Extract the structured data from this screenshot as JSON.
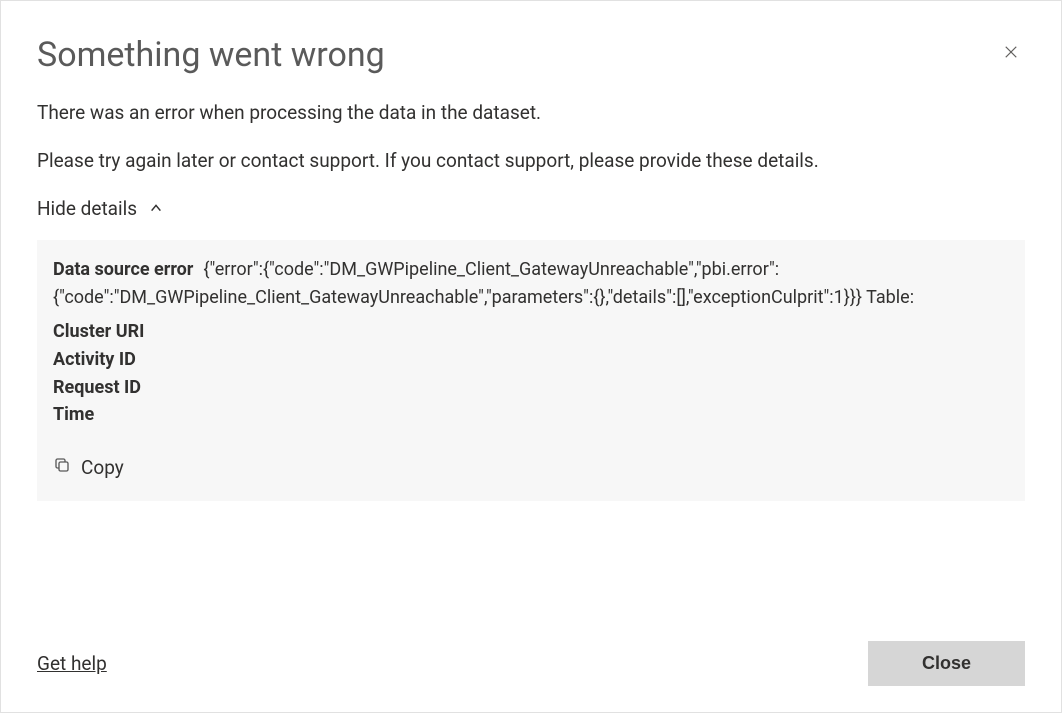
{
  "dialog": {
    "title": "Something went wrong",
    "message1": "There was an error when processing the data in the dataset.",
    "message2": "Please try again later or contact support. If you contact support, please provide these details.",
    "toggle_label": "Hide details"
  },
  "details": {
    "data_source_error_label": "Data source error",
    "data_source_error_value": "{\"error\":{\"code\":\"DM_GWPipeline_Client_GatewayUnreachable\",\"pbi.error\":{\"code\":\"DM_GWPipeline_Client_GatewayUnreachable\",\"parameters\":{},\"details\":[],\"exceptionCulprit\":1}}} Table:",
    "cluster_uri_label": "Cluster URI",
    "cluster_uri_value": "",
    "activity_id_label": "Activity ID",
    "activity_id_value": "",
    "request_id_label": "Request ID",
    "request_id_value": "",
    "time_label": "Time",
    "time_value": "",
    "copy_label": "Copy"
  },
  "footer": {
    "help_link": "Get help",
    "close_button": "Close"
  }
}
